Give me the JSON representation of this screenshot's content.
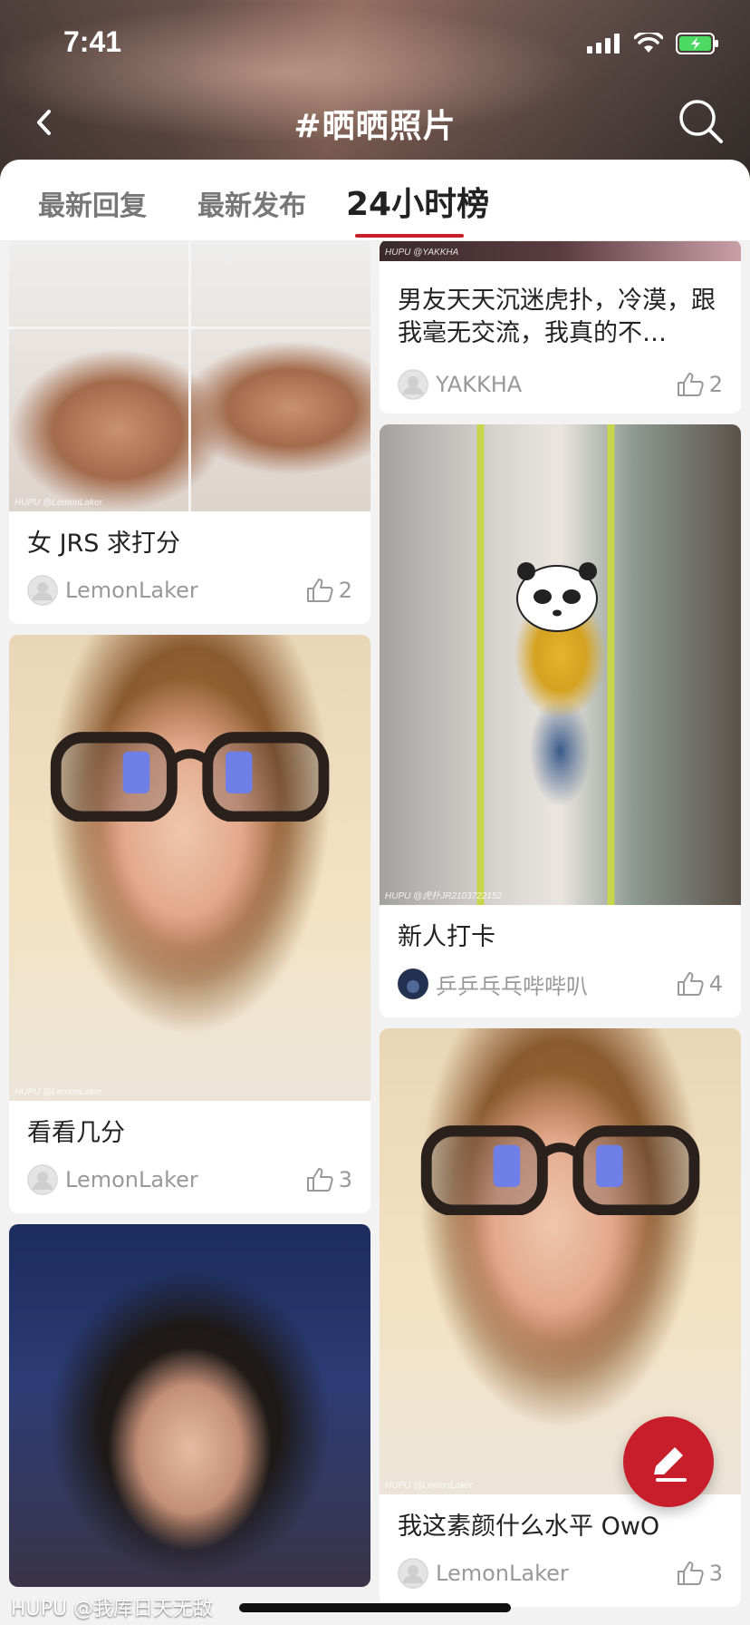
{
  "status_bar": {
    "time": "7:41"
  },
  "nav": {
    "title": "#晒晒照片"
  },
  "tabs": [
    {
      "label": "最新回复",
      "active": false
    },
    {
      "label": "最新发布",
      "active": false
    },
    {
      "label": "24小时榜",
      "active": true
    }
  ],
  "feed": {
    "left": [
      {
        "title": "女 JRS 求打分",
        "author": "LemonLaker",
        "likes": "2",
        "watermark": "HUPU @LemonLaker"
      },
      {
        "title": "看看几分",
        "author": "LemonLaker",
        "likes": "3",
        "watermark": "HUPU @LemonLaker"
      },
      {
        "title": "",
        "author": "",
        "likes": "",
        "watermark": ""
      }
    ],
    "right": [
      {
        "title": "男友天天沉迷虎扑，冷漠，跟我毫无交流，我真的不…",
        "author": "YAKKHA",
        "likes": "2",
        "watermark": "HUPU @YAKKHA"
      },
      {
        "title": "新人打卡",
        "author": "乒乒乓乓哔哔叭",
        "likes": "4",
        "watermark": "HUPU @虎扑JR2103722152"
      },
      {
        "title": "我这素颜什么水平 OwO",
        "author": "LemonLaker",
        "likes": "3",
        "watermark": "HUPU @LemonLaker"
      }
    ]
  },
  "bottom_watermark": "HUPU @我库日天无敌",
  "colors": {
    "accent": "#c81e2b"
  },
  "icons": [
    "back-icon",
    "search-icon",
    "like-icon",
    "avatar-icon",
    "edit-icon",
    "signal-icon",
    "wifi-icon",
    "battery-icon"
  ]
}
